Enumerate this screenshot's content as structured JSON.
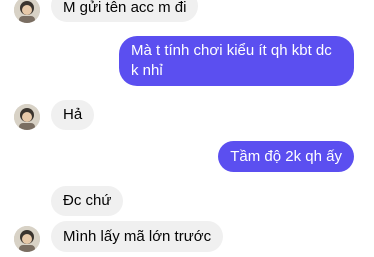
{
  "colors": {
    "incoming_bubble": "#f0f0f0",
    "outgoing_bubble": "#5b4ff0",
    "outgoing_text": "#ffffff",
    "incoming_text": "#050505"
  },
  "messages": [
    {
      "sender": "other",
      "text": "M gửi tên acc m đi"
    },
    {
      "sender": "me",
      "lines": [
        "Mà t tính chơi kiểu ít qh kbt dc",
        "k nhỉ"
      ]
    },
    {
      "sender": "other",
      "text": "Hả"
    },
    {
      "sender": "me",
      "text": "Tầm độ 2k qh ấy"
    },
    {
      "sender": "other",
      "text": "Đc chứ"
    },
    {
      "sender": "other",
      "text": "Mình lấy mã lớn trước"
    }
  ],
  "avatar_icon": "person-photo-avatar"
}
